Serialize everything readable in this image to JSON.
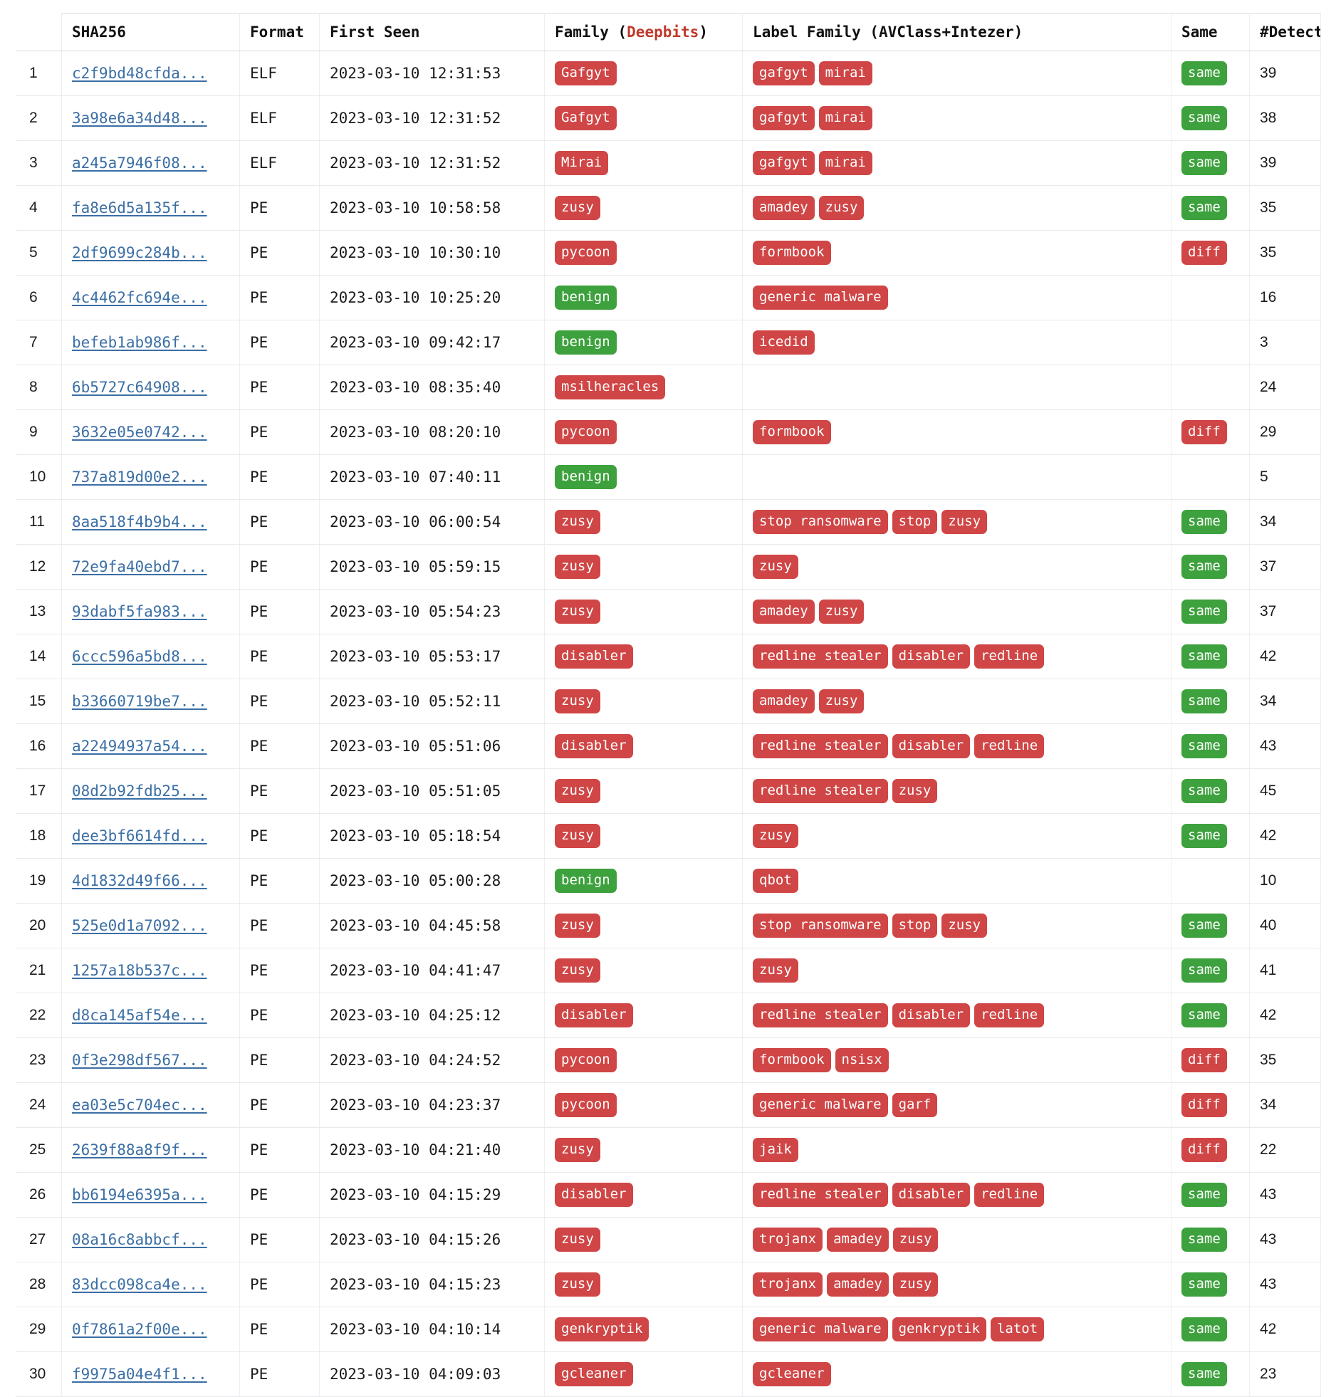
{
  "table": {
    "columns": [
      {
        "key": "index",
        "label": ""
      },
      {
        "key": "sha256",
        "label": "SHA256"
      },
      {
        "key": "format",
        "label": "Format"
      },
      {
        "key": "first_seen",
        "label": "First Seen"
      },
      {
        "key": "family",
        "label_prefix": "Family (",
        "label_accent": "Deepbits",
        "label_suffix": ")"
      },
      {
        "key": "label_family",
        "label": "Label Family (AVClass+Intezer)"
      },
      {
        "key": "same",
        "label": "Same"
      },
      {
        "key": "detect",
        "label": "#Detect"
      }
    ],
    "colors": {
      "badge_red": "#d04545",
      "badge_green": "#3da13d",
      "link_blue": "#3a6ea5",
      "accent_red": "#c0392b",
      "border": "#e9e9ec"
    },
    "rows": [
      {
        "index": "1",
        "sha256": "c2f9bd48cfda...",
        "format": "ELF",
        "first_seen": "2023-03-10 12:31:53",
        "family": {
          "text": "Gafgyt",
          "tone": "red"
        },
        "label_family": [
          {
            "text": "gafgyt",
            "tone": "red"
          },
          {
            "text": "mirai",
            "tone": "red"
          }
        ],
        "same": {
          "text": "same",
          "tone": "green"
        },
        "detect": "39"
      },
      {
        "index": "2",
        "sha256": "3a98e6a34d48...",
        "format": "ELF",
        "first_seen": "2023-03-10 12:31:52",
        "family": {
          "text": "Gafgyt",
          "tone": "red"
        },
        "label_family": [
          {
            "text": "gafgyt",
            "tone": "red"
          },
          {
            "text": "mirai",
            "tone": "red"
          }
        ],
        "same": {
          "text": "same",
          "tone": "green"
        },
        "detect": "38"
      },
      {
        "index": "3",
        "sha256": "a245a7946f08...",
        "format": "ELF",
        "first_seen": "2023-03-10 12:31:52",
        "family": {
          "text": "Mirai",
          "tone": "red"
        },
        "label_family": [
          {
            "text": "gafgyt",
            "tone": "red"
          },
          {
            "text": "mirai",
            "tone": "red"
          }
        ],
        "same": {
          "text": "same",
          "tone": "green"
        },
        "detect": "39"
      },
      {
        "index": "4",
        "sha256": "fa8e6d5a135f...",
        "format": "PE",
        "first_seen": "2023-03-10 10:58:58",
        "family": {
          "text": "zusy",
          "tone": "red"
        },
        "label_family": [
          {
            "text": "amadey",
            "tone": "red"
          },
          {
            "text": "zusy",
            "tone": "red"
          }
        ],
        "same": {
          "text": "same",
          "tone": "green"
        },
        "detect": "35"
      },
      {
        "index": "5",
        "sha256": "2df9699c284b...",
        "format": "PE",
        "first_seen": "2023-03-10 10:30:10",
        "family": {
          "text": "pycoon",
          "tone": "red"
        },
        "label_family": [
          {
            "text": "formbook",
            "tone": "red"
          }
        ],
        "same": {
          "text": "diff",
          "tone": "red"
        },
        "detect": "35"
      },
      {
        "index": "6",
        "sha256": "4c4462fc694e...",
        "format": "PE",
        "first_seen": "2023-03-10 10:25:20",
        "family": {
          "text": "benign",
          "tone": "green"
        },
        "label_family": [
          {
            "text": "generic malware",
            "tone": "red"
          }
        ],
        "same": null,
        "detect": "16"
      },
      {
        "index": "7",
        "sha256": "befeb1ab986f...",
        "format": "PE",
        "first_seen": "2023-03-10 09:42:17",
        "family": {
          "text": "benign",
          "tone": "green"
        },
        "label_family": [
          {
            "text": "icedid",
            "tone": "red"
          }
        ],
        "same": null,
        "detect": "3"
      },
      {
        "index": "8",
        "sha256": "6b5727c64908...",
        "format": "PE",
        "first_seen": "2023-03-10 08:35:40",
        "family": {
          "text": "msilheracles",
          "tone": "red"
        },
        "label_family": [],
        "same": null,
        "detect": "24"
      },
      {
        "index": "9",
        "sha256": "3632e05e0742...",
        "format": "PE",
        "first_seen": "2023-03-10 08:20:10",
        "family": {
          "text": "pycoon",
          "tone": "red"
        },
        "label_family": [
          {
            "text": "formbook",
            "tone": "red"
          }
        ],
        "same": {
          "text": "diff",
          "tone": "red"
        },
        "detect": "29"
      },
      {
        "index": "10",
        "sha256": "737a819d00e2...",
        "format": "PE",
        "first_seen": "2023-03-10 07:40:11",
        "family": {
          "text": "benign",
          "tone": "green"
        },
        "label_family": [],
        "same": null,
        "detect": "5"
      },
      {
        "index": "11",
        "sha256": "8aa518f4b9b4...",
        "format": "PE",
        "first_seen": "2023-03-10 06:00:54",
        "family": {
          "text": "zusy",
          "tone": "red"
        },
        "label_family": [
          {
            "text": "stop ransomware",
            "tone": "red"
          },
          {
            "text": "stop",
            "tone": "red"
          },
          {
            "text": "zusy",
            "tone": "red"
          }
        ],
        "same": {
          "text": "same",
          "tone": "green"
        },
        "detect": "34"
      },
      {
        "index": "12",
        "sha256": "72e9fa40ebd7...",
        "format": "PE",
        "first_seen": "2023-03-10 05:59:15",
        "family": {
          "text": "zusy",
          "tone": "red"
        },
        "label_family": [
          {
            "text": "zusy",
            "tone": "red"
          }
        ],
        "same": {
          "text": "same",
          "tone": "green"
        },
        "detect": "37"
      },
      {
        "index": "13",
        "sha256": "93dabf5fa983...",
        "format": "PE",
        "first_seen": "2023-03-10 05:54:23",
        "family": {
          "text": "zusy",
          "tone": "red"
        },
        "label_family": [
          {
            "text": "amadey",
            "tone": "red"
          },
          {
            "text": "zusy",
            "tone": "red"
          }
        ],
        "same": {
          "text": "same",
          "tone": "green"
        },
        "detect": "37"
      },
      {
        "index": "14",
        "sha256": "6ccc596a5bd8...",
        "format": "PE",
        "first_seen": "2023-03-10 05:53:17",
        "family": {
          "text": "disabler",
          "tone": "red"
        },
        "label_family": [
          {
            "text": "redline stealer",
            "tone": "red"
          },
          {
            "text": "disabler",
            "tone": "red"
          },
          {
            "text": "redline",
            "tone": "red"
          }
        ],
        "same": {
          "text": "same",
          "tone": "green"
        },
        "detect": "42"
      },
      {
        "index": "15",
        "sha256": "b33660719be7...",
        "format": "PE",
        "first_seen": "2023-03-10 05:52:11",
        "family": {
          "text": "zusy",
          "tone": "red"
        },
        "label_family": [
          {
            "text": "amadey",
            "tone": "red"
          },
          {
            "text": "zusy",
            "tone": "red"
          }
        ],
        "same": {
          "text": "same",
          "tone": "green"
        },
        "detect": "34"
      },
      {
        "index": "16",
        "sha256": "a22494937a54...",
        "format": "PE",
        "first_seen": "2023-03-10 05:51:06",
        "family": {
          "text": "disabler",
          "tone": "red"
        },
        "label_family": [
          {
            "text": "redline stealer",
            "tone": "red"
          },
          {
            "text": "disabler",
            "tone": "red"
          },
          {
            "text": "redline",
            "tone": "red"
          }
        ],
        "same": {
          "text": "same",
          "tone": "green"
        },
        "detect": "43"
      },
      {
        "index": "17",
        "sha256": "08d2b92fdb25...",
        "format": "PE",
        "first_seen": "2023-03-10 05:51:05",
        "family": {
          "text": "zusy",
          "tone": "red"
        },
        "label_family": [
          {
            "text": "redline stealer",
            "tone": "red"
          },
          {
            "text": "zusy",
            "tone": "red"
          }
        ],
        "same": {
          "text": "same",
          "tone": "green"
        },
        "detect": "45"
      },
      {
        "index": "18",
        "sha256": "dee3bf6614fd...",
        "format": "PE",
        "first_seen": "2023-03-10 05:18:54",
        "family": {
          "text": "zusy",
          "tone": "red"
        },
        "label_family": [
          {
            "text": "zusy",
            "tone": "red"
          }
        ],
        "same": {
          "text": "same",
          "tone": "green"
        },
        "detect": "42"
      },
      {
        "index": "19",
        "sha256": "4d1832d49f66...",
        "format": "PE",
        "first_seen": "2023-03-10 05:00:28",
        "family": {
          "text": "benign",
          "tone": "green"
        },
        "label_family": [
          {
            "text": "qbot",
            "tone": "red"
          }
        ],
        "same": null,
        "detect": "10"
      },
      {
        "index": "20",
        "sha256": "525e0d1a7092...",
        "format": "PE",
        "first_seen": "2023-03-10 04:45:58",
        "family": {
          "text": "zusy",
          "tone": "red"
        },
        "label_family": [
          {
            "text": "stop ransomware",
            "tone": "red"
          },
          {
            "text": "stop",
            "tone": "red"
          },
          {
            "text": "zusy",
            "tone": "red"
          }
        ],
        "same": {
          "text": "same",
          "tone": "green"
        },
        "detect": "40"
      },
      {
        "index": "21",
        "sha256": "1257a18b537c...",
        "format": "PE",
        "first_seen": "2023-03-10 04:41:47",
        "family": {
          "text": "zusy",
          "tone": "red"
        },
        "label_family": [
          {
            "text": "zusy",
            "tone": "red"
          }
        ],
        "same": {
          "text": "same",
          "tone": "green"
        },
        "detect": "41"
      },
      {
        "index": "22",
        "sha256": "d8ca145af54e...",
        "format": "PE",
        "first_seen": "2023-03-10 04:25:12",
        "family": {
          "text": "disabler",
          "tone": "red"
        },
        "label_family": [
          {
            "text": "redline stealer",
            "tone": "red"
          },
          {
            "text": "disabler",
            "tone": "red"
          },
          {
            "text": "redline",
            "tone": "red"
          }
        ],
        "same": {
          "text": "same",
          "tone": "green"
        },
        "detect": "42"
      },
      {
        "index": "23",
        "sha256": "0f3e298df567...",
        "format": "PE",
        "first_seen": "2023-03-10 04:24:52",
        "family": {
          "text": "pycoon",
          "tone": "red"
        },
        "label_family": [
          {
            "text": "formbook",
            "tone": "red"
          },
          {
            "text": "nsisx",
            "tone": "red"
          }
        ],
        "same": {
          "text": "diff",
          "tone": "red"
        },
        "detect": "35"
      },
      {
        "index": "24",
        "sha256": "ea03e5c704ec...",
        "format": "PE",
        "first_seen": "2023-03-10 04:23:37",
        "family": {
          "text": "pycoon",
          "tone": "red"
        },
        "label_family": [
          {
            "text": "generic malware",
            "tone": "red"
          },
          {
            "text": "garf",
            "tone": "red"
          }
        ],
        "same": {
          "text": "diff",
          "tone": "red"
        },
        "detect": "34"
      },
      {
        "index": "25",
        "sha256": "2639f88a8f9f...",
        "format": "PE",
        "first_seen": "2023-03-10 04:21:40",
        "family": {
          "text": "zusy",
          "tone": "red"
        },
        "label_family": [
          {
            "text": "jaik",
            "tone": "red"
          }
        ],
        "same": {
          "text": "diff",
          "tone": "red"
        },
        "detect": "22"
      },
      {
        "index": "26",
        "sha256": "bb6194e6395a...",
        "format": "PE",
        "first_seen": "2023-03-10 04:15:29",
        "family": {
          "text": "disabler",
          "tone": "red"
        },
        "label_family": [
          {
            "text": "redline stealer",
            "tone": "red"
          },
          {
            "text": "disabler",
            "tone": "red"
          },
          {
            "text": "redline",
            "tone": "red"
          }
        ],
        "same": {
          "text": "same",
          "tone": "green"
        },
        "detect": "43"
      },
      {
        "index": "27",
        "sha256": "08a16c8abbcf...",
        "format": "PE",
        "first_seen": "2023-03-10 04:15:26",
        "family": {
          "text": "zusy",
          "tone": "red"
        },
        "label_family": [
          {
            "text": "trojanx",
            "tone": "red"
          },
          {
            "text": "amadey",
            "tone": "red"
          },
          {
            "text": "zusy",
            "tone": "red"
          }
        ],
        "same": {
          "text": "same",
          "tone": "green"
        },
        "detect": "43"
      },
      {
        "index": "28",
        "sha256": "83dcc098ca4e...",
        "format": "PE",
        "first_seen": "2023-03-10 04:15:23",
        "family": {
          "text": "zusy",
          "tone": "red"
        },
        "label_family": [
          {
            "text": "trojanx",
            "tone": "red"
          },
          {
            "text": "amadey",
            "tone": "red"
          },
          {
            "text": "zusy",
            "tone": "red"
          }
        ],
        "same": {
          "text": "same",
          "tone": "green"
        },
        "detect": "43"
      },
      {
        "index": "29",
        "sha256": "0f7861a2f00e...",
        "format": "PE",
        "first_seen": "2023-03-10 04:10:14",
        "family": {
          "text": "genkryptik",
          "tone": "red"
        },
        "label_family": [
          {
            "text": "generic malware",
            "tone": "red"
          },
          {
            "text": "genkryptik",
            "tone": "red"
          },
          {
            "text": "latot",
            "tone": "red"
          }
        ],
        "same": {
          "text": "same",
          "tone": "green"
        },
        "detect": "42"
      },
      {
        "index": "30",
        "sha256": "f9975a04e4f1...",
        "format": "PE",
        "first_seen": "2023-03-10 04:09:03",
        "family": {
          "text": "gcleaner",
          "tone": "red"
        },
        "label_family": [
          {
            "text": "gcleaner",
            "tone": "red"
          }
        ],
        "same": {
          "text": "same",
          "tone": "green"
        },
        "detect": "23"
      }
    ]
  }
}
